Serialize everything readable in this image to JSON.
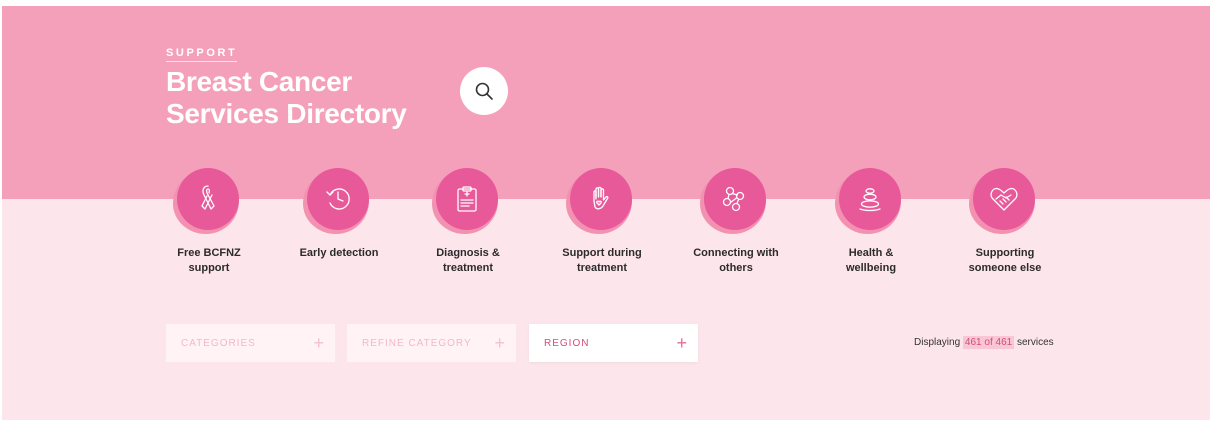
{
  "header": {
    "eyebrow": "SUPPORT",
    "title_line1": "Breast Cancer",
    "title_line2": "Services Directory",
    "search_icon": "search-icon"
  },
  "colors": {
    "hero": "#f5a0ba",
    "background": "#fde5ec",
    "accent": "#e8599a",
    "accent_text": "#d44c7f"
  },
  "categories": [
    {
      "label_line1": "Free BCFNZ",
      "label_line2": "support",
      "icon": "ribbon-icon"
    },
    {
      "label_line1": "Early detection",
      "label_line2": "",
      "icon": "clock-icon"
    },
    {
      "label_line1": "Diagnosis &",
      "label_line2": "treatment",
      "icon": "clipboard-icon"
    },
    {
      "label_line1": "Support during",
      "label_line2": "treatment",
      "icon": "hand-heart-icon"
    },
    {
      "label_line1": "Connecting with",
      "label_line2": "others",
      "icon": "network-icon"
    },
    {
      "label_line1": "Health &",
      "label_line2": "wellbeing",
      "icon": "stones-icon"
    },
    {
      "label_line1": "Supporting",
      "label_line2": "someone else",
      "icon": "handshake-heart-icon"
    }
  ],
  "filters": [
    {
      "label": "CATEGORIES",
      "symbol": "+"
    },
    {
      "label": "REFINE CATEGORY",
      "symbol": "+"
    },
    {
      "label": "REGION",
      "symbol": "+"
    }
  ],
  "results": {
    "prefix": "Displaying",
    "count": "461 of 461",
    "suffix": "services"
  }
}
